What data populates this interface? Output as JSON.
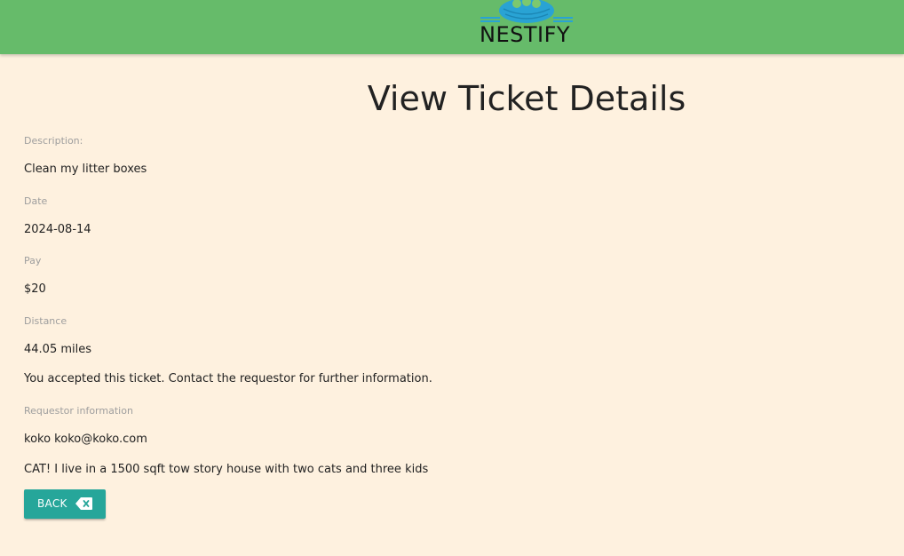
{
  "header": {
    "brand_name": "NESTIFY",
    "background_color": "#66bb6a",
    "logo_icon": "nest-logo-icon"
  },
  "page": {
    "title": "View Ticket Details",
    "background_color": "#fef1df"
  },
  "ticket": {
    "description_label": "Description:",
    "description_value": "Clean my litter boxes",
    "date_label": "Date",
    "date_value": "2024-08-14",
    "pay_label": "Pay",
    "pay_value": "$20",
    "distance_label": "Distance",
    "distance_value": "44.05 miles",
    "status_message": "You accepted this ticket. Contact the requestor for further information.",
    "requestor_label": "Requestor information",
    "requestor_value": "koko koko@koko.com",
    "requestor_details": "CAT! I live in a 1500 sqft tow story house with two cats and three kids"
  },
  "actions": {
    "back_label": "BACK",
    "back_icon": "backspace-icon",
    "accent_color": "#26a69a"
  }
}
